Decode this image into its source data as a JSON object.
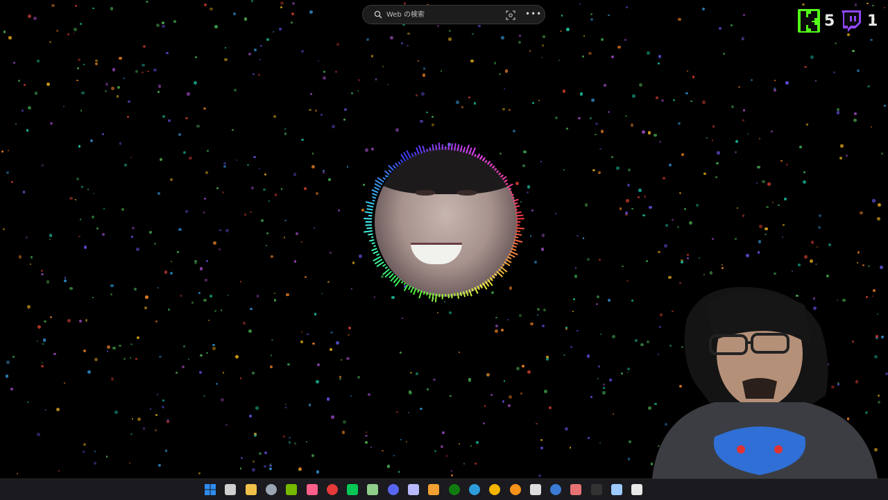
{
  "search": {
    "placeholder": "Web の検索",
    "icon": "search-icon",
    "visual_search_icon": "visual-search-icon",
    "more_label": "•••"
  },
  "counters": [
    {
      "platform": "kick",
      "icon": "kick-logo-icon",
      "count": "5",
      "color": "#53fc18"
    },
    {
      "platform": "twitch",
      "icon": "twitch-logo-icon",
      "count": "1",
      "color": "#9146ff"
    }
  ],
  "colors": {
    "background": "#000000",
    "taskbar": "#1a1a1f",
    "kick": "#53fc18",
    "twitch": "#9146ff"
  },
  "taskbar": {
    "items": [
      {
        "name": "start-button",
        "icon": "windows-start-icon",
        "color": "#2f8cf0"
      },
      {
        "name": "taskview-button",
        "icon": "task-view-icon",
        "color": "#cfcfcf"
      },
      {
        "name": "explorer-button",
        "icon": "folder-icon",
        "color": "#f2c14a"
      },
      {
        "name": "app-button-1",
        "icon": "steam-icon",
        "color": "#9aa6b4"
      },
      {
        "name": "app-button-2",
        "icon": "nvidia-icon",
        "color": "#76b900"
      },
      {
        "name": "app-button-3",
        "icon": "lips-icon",
        "color": "#ff5f8a"
      },
      {
        "name": "app-button-4",
        "icon": "record-icon",
        "color": "#e5393a"
      },
      {
        "name": "app-button-5",
        "icon": "line-icon",
        "color": "#06c755"
      },
      {
        "name": "app-button-6",
        "icon": "v-app-icon",
        "color": "#8fcf8a"
      },
      {
        "name": "app-button-7",
        "icon": "discord-icon",
        "color": "#5865f2"
      },
      {
        "name": "app-button-8",
        "icon": "globe-icon",
        "color": "#b9b9ff"
      },
      {
        "name": "app-button-9",
        "icon": "document-icon",
        "color": "#f0a030"
      },
      {
        "name": "app-button-10",
        "icon": "xbox-icon",
        "color": "#107c10"
      },
      {
        "name": "app-button-11",
        "icon": "edge-icon",
        "color": "#2d9cdb"
      },
      {
        "name": "app-button-12",
        "icon": "chrome-icon",
        "color": "#f4b400"
      },
      {
        "name": "app-button-13",
        "icon": "bitcoin-icon",
        "color": "#f7931a"
      },
      {
        "name": "app-button-14",
        "icon": "c-app-icon",
        "color": "#dddddd"
      },
      {
        "name": "app-button-15",
        "icon": "browser-icon",
        "color": "#3a7bd5"
      },
      {
        "name": "app-button-16",
        "icon": "image-icon",
        "color": "#e57373"
      },
      {
        "name": "app-button-17",
        "icon": "spider-icon",
        "color": "#333333"
      },
      {
        "name": "app-button-18",
        "icon": "app-s-icon",
        "color": "#9ecbff"
      },
      {
        "name": "app-button-19",
        "icon": "app-x-icon",
        "color": "#e8e8e8"
      }
    ]
  }
}
